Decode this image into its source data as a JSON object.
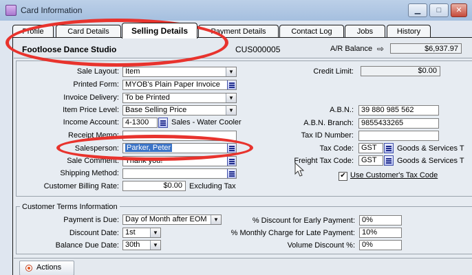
{
  "window": {
    "title": "Card Information",
    "minimize": "▁",
    "maximize": "□",
    "close": "✕"
  },
  "tabs": [
    {
      "label": "Profile",
      "active": false
    },
    {
      "label": "Card Details",
      "active": false
    },
    {
      "label": "Selling Details",
      "active": true
    },
    {
      "label": "Payment Details",
      "active": false
    },
    {
      "label": "Contact Log",
      "active": false
    },
    {
      "label": "Jobs",
      "active": false
    },
    {
      "label": "History",
      "active": false
    }
  ],
  "header": {
    "card_name": "Footloose Dance Studio",
    "card_id": "CUS000005",
    "ar_label": "A/R Balance",
    "ar_arrow": "⇨",
    "ar_value": "$6,937.97"
  },
  "selling": {
    "sale_layout": {
      "label": "Sale Layout:",
      "value": "Item"
    },
    "printed_form": {
      "label": "Printed Form:",
      "value": "MYOB's Plain Paper Invoice"
    },
    "invoice_delivery": {
      "label": "Invoice Delivery:",
      "value": "To be Printed"
    },
    "item_price_level": {
      "label": "Item Price Level:",
      "value": "Base Selling Price"
    },
    "income_account": {
      "label": "Income Account:",
      "value": "4-1300",
      "description": "Sales - Water Cooler"
    },
    "receipt_memo": {
      "label": "Receipt Memo:",
      "value": ""
    },
    "salesperson": {
      "label": "Salesperson:",
      "value": "Parker, Peter"
    },
    "sale_comment": {
      "label": "Sale Comment:",
      "value": "Thank you!"
    },
    "shipping_method": {
      "label": "Shipping Method:",
      "value": ""
    },
    "billing_rate": {
      "label": "Customer Billing Rate:",
      "value": "$0.00",
      "suffix": "Excluding Tax"
    }
  },
  "right": {
    "credit_limit": {
      "label": "Credit Limit:",
      "value": "$0.00"
    },
    "abn": {
      "label": "A.B.N.:",
      "value": "39 880 985 562"
    },
    "abn_branch": {
      "label": "A.B.N. Branch:",
      "value": "9855433265"
    },
    "tax_id": {
      "label": "Tax ID Number:",
      "value": ""
    },
    "tax_code": {
      "label": "Tax Code:",
      "value": "GST",
      "description": "Goods & Services T"
    },
    "freight_tax_code": {
      "label": "Freight Tax Code:",
      "value": "GST",
      "description": "Goods & Services T"
    },
    "use_customer_tax": {
      "label": "Use Customer's Tax Code",
      "checked": "✔"
    }
  },
  "terms": {
    "title": "Customer Terms Information",
    "payment_due": {
      "label": "Payment is Due:",
      "value": "Day of Month after EOM"
    },
    "discount_date": {
      "label": "Discount Date:",
      "value": "1st"
    },
    "balance_due_date": {
      "label": "Balance Due Date:",
      "value": "30th"
    },
    "early_discount": {
      "label": "% Discount for Early Payment:",
      "value": "0%"
    },
    "late_charge": {
      "label": "% Monthly Charge for Late Payment:",
      "value": "10%"
    },
    "volume_discount": {
      "label": "Volume Discount %:",
      "value": "0%"
    }
  },
  "actions": {
    "label": "Actions"
  },
  "colors": {
    "annotation": "#e8332d",
    "selection": "#3b74c7",
    "titlebar": "#a5bfdf"
  }
}
